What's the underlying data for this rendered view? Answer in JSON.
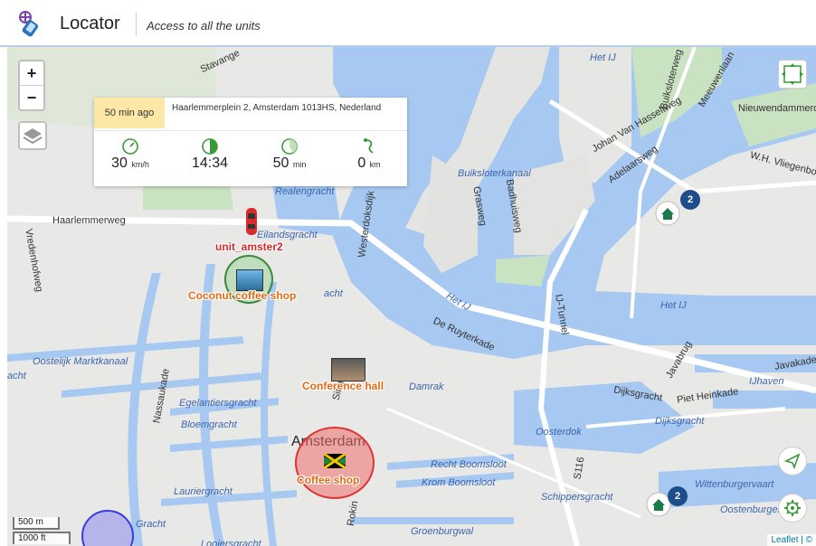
{
  "header": {
    "title": "Locator",
    "subtitle": "Access to all the units"
  },
  "map_controls": {
    "zoom_in": "+",
    "zoom_out": "−"
  },
  "info_panel": {
    "time_ago": "50 min ago",
    "address": "Haarlemmerplein 2, Amsterdam 1013HS, Nederland",
    "speed": {
      "value": "30",
      "unit": "km/h"
    },
    "time": {
      "value": "14:34",
      "unit": ""
    },
    "duration": {
      "value": "50",
      "unit": "min"
    },
    "distance": {
      "value": "0",
      "unit": "km"
    }
  },
  "markers": {
    "unit": "unit_amster2",
    "coconut": "Coconut coffee shop",
    "conference": "Conference hall",
    "coffee": "Coffee shop"
  },
  "clusters": [
    "2",
    "2"
  ],
  "map_labels": {
    "haarlemmerweg": "Haarlemmerweg",
    "realengracht": "Realengracht",
    "eilandsgracht": "Eilandsgracht",
    "westerdoksdijk": "Westerdoksdijk",
    "stavangerweg": "Stavange",
    "oostelijk_marktkanaal": "Oostelijk Marktkanaal",
    "egelantiersgracht": "Egelantiersgracht",
    "bloemgracht": "Bloemgracht",
    "lauriergracht": "Lauriergracht",
    "rozengracht": "Rozengracht",
    "looiersgracht": "Looiersgracht",
    "nassaukade": "Nassaukade",
    "singel": "Singel",
    "damrak": "Damrak",
    "amsterdam": "Amsterdam",
    "recht_boomsloot": "Recht Boomsloot",
    "krom_boomsloot": "Krom Boomsloot",
    "groenburgwal": "Groenburgwal",
    "rokin": "Rokin",
    "schippersgracht": "Schippersgracht",
    "oosterdok": "Oosterdok",
    "s116": "S116",
    "dijksgracht": "Dijksgracht",
    "dijksgracht2": "Dijksgracht",
    "piet_heinkade": "Piet Heinkade",
    "ijhaven": "IJhaven",
    "javakade": "Javakade",
    "de_ruyterkade": "De Ruyterkade",
    "het_ij": "Het IJ",
    "het_ij2": "Het IJ",
    "het_ij3": "Het IJ",
    "ij_tunnel": "IJ-Tunnel",
    "buiksloterkanaal": "Buiksloterkanaal",
    "johan_van_hasseltweg": "Johan Van Hasseltweg",
    "adelaarsweg": "Adelaarsweg",
    "nieuwendammerdijk": "Nieuwendammerdijk",
    "wh_vliegenbos": "W.H. Vliegenbos",
    "buiksloterweg": "Buiksloterweg",
    "grasweg": "Grasweg",
    "badhuisweg": "Badhuisweg",
    "meeuwenlaan": "Meeuwenlaan",
    "wittenburgervaart": "Wittenburgervaart",
    "oostenburgervaart": "Oostenburgerva",
    "vredenhofweg": "Vredenhofweg",
    "javabrug": "Javabrug",
    "gracht": "Gracht",
    "acht": "acht",
    "acht2": "acht"
  },
  "scale": {
    "metric": "500 m",
    "imperial": "1000 ft"
  },
  "attribution": "Leaflet | ©",
  "colors": {
    "water": "#a7c8f0",
    "land": "#e8e8e6",
    "park": "#c9e2c2",
    "accent": "#e86812",
    "cluster": "#1d4e8b"
  }
}
